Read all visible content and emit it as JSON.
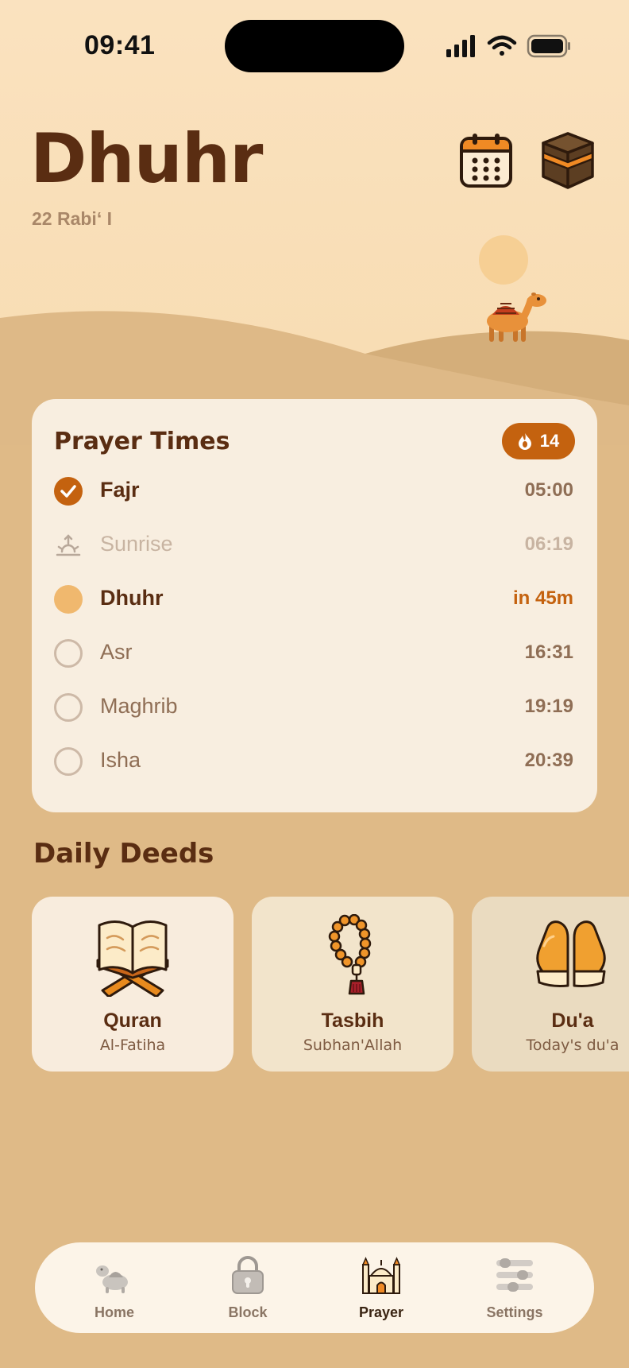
{
  "status_bar": {
    "time": "09:41"
  },
  "header": {
    "title": "Dhuhr",
    "hijri_date": "22 Rabiʻ I",
    "calendar_icon": "calendar-icon",
    "kaaba_icon": "kaaba-icon"
  },
  "prayer_card": {
    "title": "Prayer Times",
    "streak": "14",
    "prayers": [
      {
        "name": "Fajr",
        "time": "05:00",
        "state": "done"
      },
      {
        "name": "Sunrise",
        "time": "06:19",
        "state": "sunrise"
      },
      {
        "name": "Dhuhr",
        "time": "in 45m",
        "state": "current"
      },
      {
        "name": "Asr",
        "time": "16:31",
        "state": "upcoming"
      },
      {
        "name": "Maghrib",
        "time": "19:19",
        "state": "upcoming"
      },
      {
        "name": "Isha",
        "time": "20:39",
        "state": "upcoming"
      }
    ]
  },
  "daily_deeds": {
    "title": "Daily Deeds",
    "items": [
      {
        "title": "Quran",
        "subtitle": "Al-Fatiha",
        "icon": "quran-icon"
      },
      {
        "title": "Tasbih",
        "subtitle": "Subhan'Allah",
        "icon": "tasbih-icon"
      },
      {
        "title": "Du'a",
        "subtitle": "Today's du'a",
        "icon": "dua-hands-icon"
      }
    ]
  },
  "tabbar": {
    "tabs": [
      {
        "label": "Home",
        "icon": "camel-icon"
      },
      {
        "label": "Block",
        "icon": "lock-icon"
      },
      {
        "label": "Prayer",
        "icon": "mosque-icon",
        "active": true
      },
      {
        "label": "Settings",
        "icon": "sliders-icon"
      }
    ]
  },
  "colors": {
    "accent": "#C4620F",
    "title": "#5A2D12",
    "background": "#DFBA87",
    "card": "#F8EEE0"
  }
}
